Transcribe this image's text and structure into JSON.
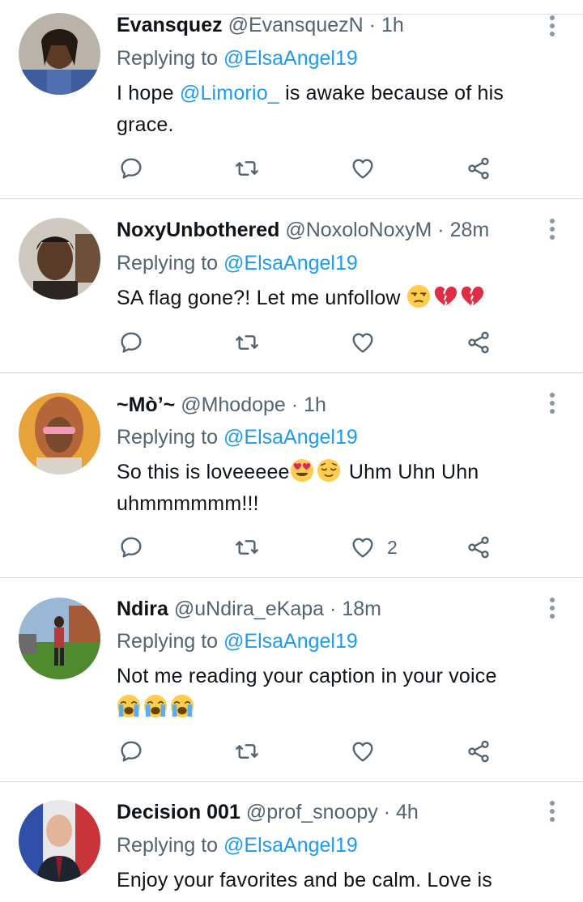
{
  "colors": {
    "link": "#1d9bf0",
    "secondary": "#536471",
    "icon": "#536471"
  },
  "tweets": [
    {
      "name": "Evansquez",
      "handle": "@EvansquezN",
      "dot": "·",
      "time": "1h",
      "replying_prefix": "Replying to",
      "replying_to": "@ElsaAngel19",
      "text_parts": [
        "I hope ",
        "@Limorio_",
        " is awake because of his grace."
      ],
      "likes": ""
    },
    {
      "name": "NoxyUnbothered",
      "handle": "@NoxoloNoxyM",
      "dot": "·",
      "time": "28m",
      "replying_prefix": "Replying to",
      "replying_to": "@ElsaAngel19",
      "text": "SA flag gone?! Let me unfollow",
      "emojis": [
        "unamused-face-emoji",
        "broken-heart-emoji",
        "broken-heart-emoji"
      ],
      "likes": ""
    },
    {
      "name": "~Mò’~",
      "handle": "@Mhodope",
      "dot": "·",
      "time": "1h",
      "replying_prefix": "Replying to",
      "replying_to": "@ElsaAngel19",
      "text_a": "So this is loveeeee",
      "text_b": "Uhm Uhn Uhn uhmmmmmm!!!",
      "emojis": [
        "heart-eyes-emoji",
        "relieved-face-emoji"
      ],
      "likes": "2"
    },
    {
      "name": "Ndira",
      "handle": "@uNdira_eKapa",
      "dot": "·",
      "time": "18m",
      "replying_prefix": "Replying to",
      "replying_to": "@ElsaAngel19",
      "text": "Not me reading your caption in your voice",
      "emojis": [
        "loudly-crying-emoji",
        "loudly-crying-emoji",
        "loudly-crying-emoji"
      ],
      "likes": ""
    },
    {
      "name": "Decision 001",
      "handle": "@prof_snoopy",
      "dot": "·",
      "time": "4h",
      "replying_prefix": "Replying to",
      "replying_to": "@ElsaAngel19",
      "text": "Enjoy your favorites and be calm. Love is",
      "likes": ""
    }
  ]
}
